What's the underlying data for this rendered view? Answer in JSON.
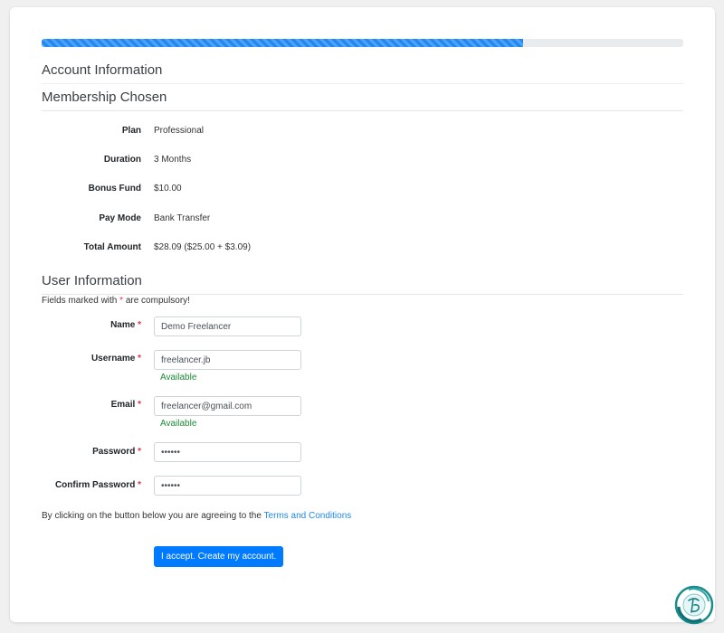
{
  "progress": {
    "fraction": 0.75,
    "color": "#1e88f4"
  },
  "sections": {
    "account": "Account Information",
    "membership": "Membership Chosen",
    "user": "User Information"
  },
  "membership": [
    {
      "label": "Plan",
      "value": "Professional"
    },
    {
      "label": "Duration",
      "value": "3 Months"
    },
    {
      "label": "Bonus Fund",
      "value": "$10.00"
    },
    {
      "label": "Pay Mode",
      "value": "Bank Transfer"
    },
    {
      "label": "Total Amount",
      "value": "$28.09 ($25.00 + $3.09)"
    }
  ],
  "compulsory_note": {
    "prefix": "Fields marked with ",
    "marker": "*",
    "suffix": " are compulsory!"
  },
  "fields": {
    "name": {
      "label": "Name",
      "value": "Demo Freelancer"
    },
    "username": {
      "label": "Username",
      "value": "freelancer.jb",
      "status": "Available"
    },
    "email": {
      "label": "Email",
      "value": "freelancer@gmail.com",
      "status": "Available"
    },
    "password": {
      "label": "Password",
      "value": "••••••"
    },
    "confirm_password": {
      "label": "Confirm Password",
      "value": "••••••"
    },
    "required_marker": "*"
  },
  "terms": {
    "text": "By clicking on the button below you are agreeing to the ",
    "link": "Terms and Conditions"
  },
  "submit_label": "I accept. Create my account.",
  "colors": {
    "primary": "#007bff",
    "required": "#dc3545",
    "available": "#1e8a37",
    "link": "#1e88e5"
  },
  "logo_icon": "site-logo-icon"
}
